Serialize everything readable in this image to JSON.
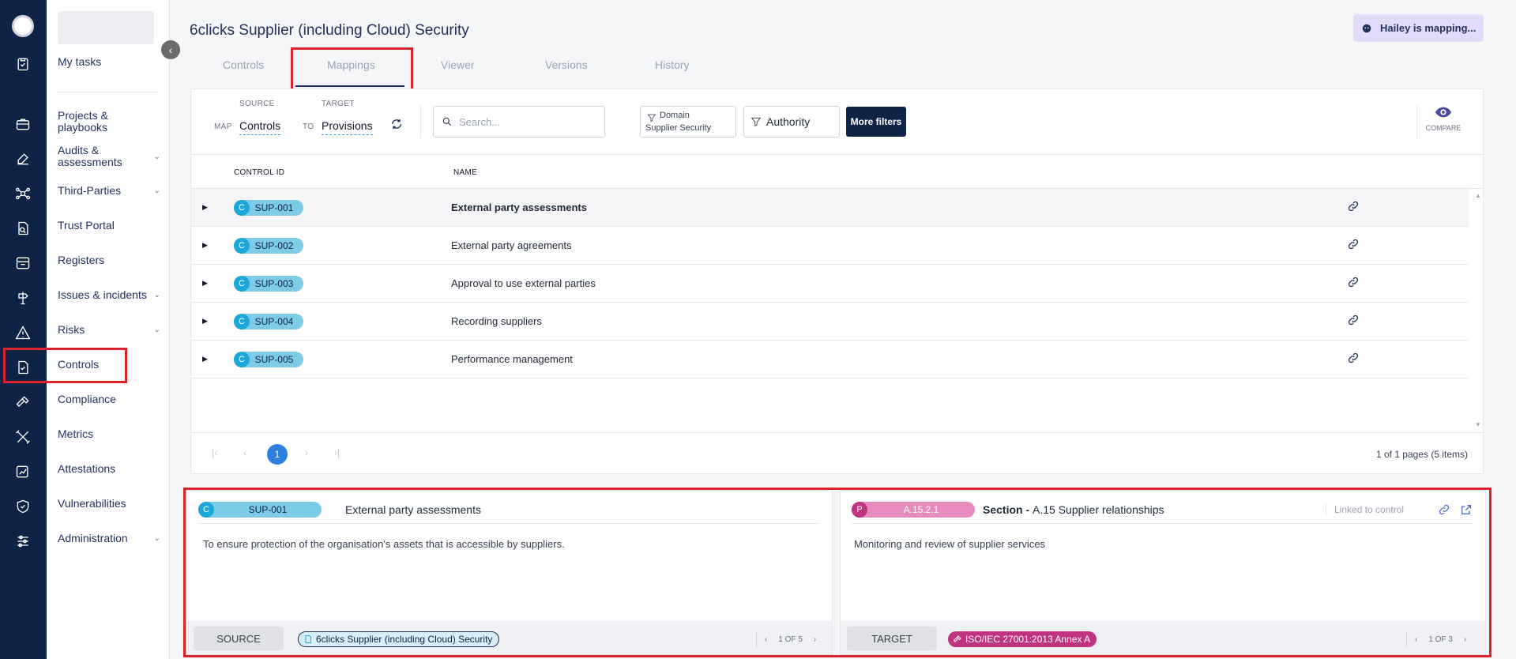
{
  "colors": {
    "rail": "#0f2347",
    "accent": "#2f7fe0",
    "control_badge": "#1ba8d8",
    "provision_badge": "#c0337f",
    "highlight": "#d9232d"
  },
  "rail_icons": [
    "clipboard-check-icon",
    "briefcase-icon",
    "edit-icon",
    "network-icon",
    "document-search-icon",
    "archive-icon",
    "signpost-icon",
    "warning-icon",
    "control-check-icon",
    "gavel-icon",
    "tools-icon",
    "chart-edit-icon",
    "shield-icon",
    "sliders-icon"
  ],
  "sidebar": {
    "items": [
      {
        "label": "My tasks",
        "chevron": false
      },
      {
        "label": "Projects & playbooks",
        "chevron": false
      },
      {
        "label": "Audits & assessments",
        "chevron": true
      },
      {
        "label": "Third-Parties",
        "chevron": true
      },
      {
        "label": "Trust Portal",
        "chevron": false
      },
      {
        "label": "Registers",
        "chevron": false
      },
      {
        "label": "Issues & incidents",
        "chevron": true
      },
      {
        "label": "Risks",
        "chevron": true
      },
      {
        "label": "Controls",
        "chevron": false
      },
      {
        "label": "Compliance",
        "chevron": false
      },
      {
        "label": "Metrics",
        "chevron": false
      },
      {
        "label": "Attestations",
        "chevron": false
      },
      {
        "label": "Vulnerabilities",
        "chevron": false
      },
      {
        "label": "Administration",
        "chevron": true
      }
    ]
  },
  "header": {
    "title": "6clicks Supplier (including Cloud) Security",
    "hailey": "Hailey is mapping...",
    "tabs": [
      "Controls",
      "Mappings",
      "Viewer",
      "Versions",
      "History"
    ],
    "active_tab": "Mappings"
  },
  "filters": {
    "map_label": "MAP",
    "source_label": "SOURCE",
    "source_value": "Controls",
    "to_label": "TO",
    "target_label": "TARGET",
    "target_value": "Provisions",
    "search_placeholder": "Search...",
    "domain_label": "Domain",
    "domain_value": "Supplier Security",
    "authority_label": "Authority",
    "more_filters": "More filters",
    "compare": "COMPARE"
  },
  "table": {
    "col_id": "CONTROL ID",
    "col_name": "NAME",
    "rows": [
      {
        "badge": "C",
        "id": "SUP-001",
        "name": "External party assessments"
      },
      {
        "badge": "C",
        "id": "SUP-002",
        "name": "External party agreements"
      },
      {
        "badge": "C",
        "id": "SUP-003",
        "name": "Approval to use external parties"
      },
      {
        "badge": "C",
        "id": "SUP-004",
        "name": "Recording suppliers"
      },
      {
        "badge": "C",
        "id": "SUP-005",
        "name": "Performance management"
      }
    ]
  },
  "pager": {
    "current": "1",
    "info": "1 of 1 pages (5 items)"
  },
  "source_pane": {
    "badge": "C",
    "id": "SUP-001",
    "title": "External party assessments",
    "description": "To ensure protection of the organisation's assets that is accessible by suppliers.",
    "role": "SOURCE",
    "framework": "6clicks Supplier (including Cloud) Security",
    "page": "1 OF 5"
  },
  "target_pane": {
    "badge": "P",
    "id": "A.15.2.1",
    "title_bold": "Section - ",
    "title_rest": "A.15 Supplier relationships",
    "linked": "Linked to control",
    "description": "Monitoring and review of supplier services",
    "role": "TARGET",
    "framework": "ISO/IEC 27001:2013 Annex A",
    "page": "1 OF 3"
  }
}
